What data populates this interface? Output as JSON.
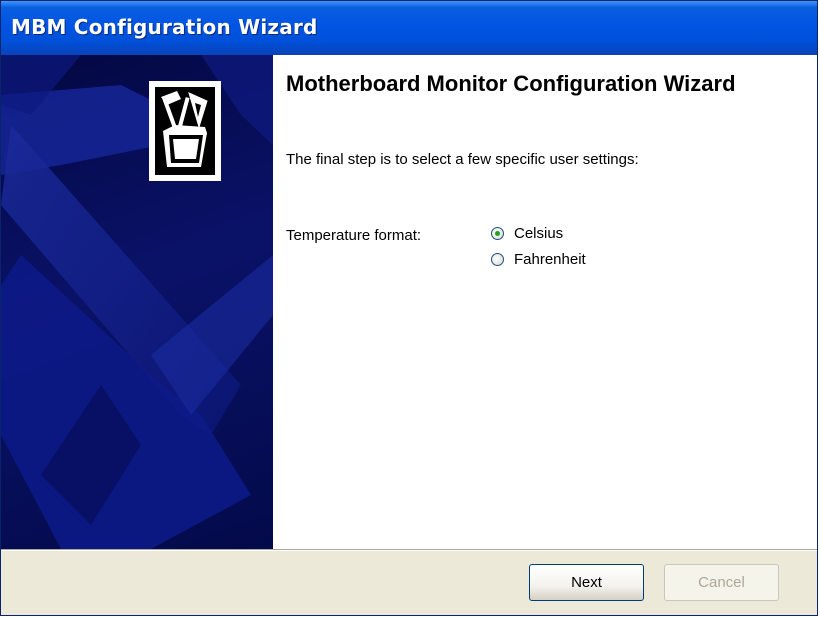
{
  "window": {
    "title": "MBM Configuration Wizard"
  },
  "sidebar": {
    "icon": "wizard-tools-folder-icon"
  },
  "content": {
    "heading": "Motherboard Monitor Configuration Wizard",
    "intro": "The final step is to select a few specific user settings:",
    "temperature": {
      "label": "Temperature format:",
      "options": [
        {
          "label": "Celsius",
          "selected": true
        },
        {
          "label": "Fahrenheit",
          "selected": false
        }
      ]
    }
  },
  "buttons": {
    "next_label": "Next",
    "cancel_label": "Cancel",
    "cancel_enabled": false
  },
  "colors": {
    "titlebar": "#0054e3",
    "sidebar": "#0a1268",
    "radio_selected": "#21a121"
  }
}
